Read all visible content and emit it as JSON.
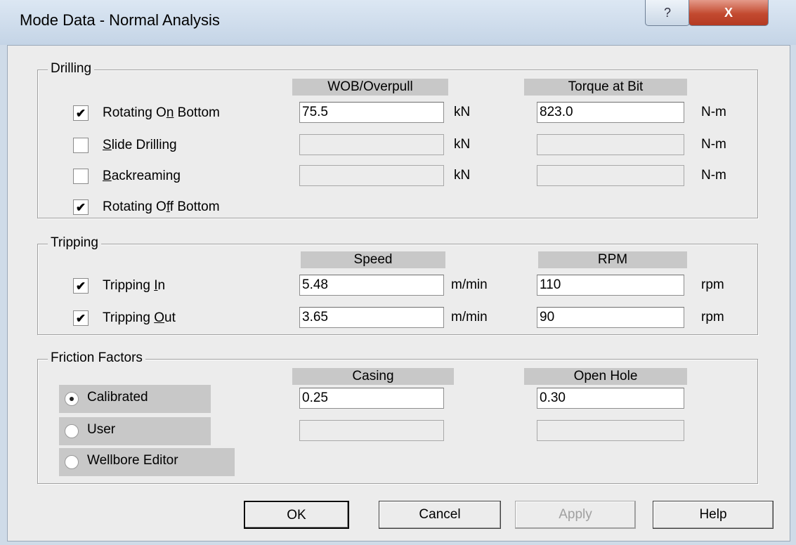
{
  "window": {
    "title": "Mode Data - Normal Analysis",
    "help_glyph": "?",
    "close_glyph": "X"
  },
  "drilling": {
    "legend": "Drilling",
    "col1_header": "WOB/Overpull",
    "col2_header": "Torque at Bit",
    "rows": [
      {
        "label_pre": "Rotating O",
        "label_u": "n",
        "label_post": " Bottom",
        "checked": true,
        "value1": "75.5",
        "unit1": "kN",
        "value2": "823.0",
        "unit2": "N-m"
      },
      {
        "label_pre": "",
        "label_u": "S",
        "label_post": "lide Drilling",
        "checked": false,
        "value1": "",
        "unit1": "kN",
        "value2": "",
        "unit2": "N-m"
      },
      {
        "label_pre": "",
        "label_u": "B",
        "label_post": "ackreaming",
        "checked": false,
        "value1": "",
        "unit1": "kN",
        "value2": "",
        "unit2": "N-m"
      },
      {
        "label_pre": "Rotating O",
        "label_u": "f",
        "label_post": "f Bottom",
        "checked": true
      }
    ]
  },
  "tripping": {
    "legend": "Tripping",
    "col1_header": "Speed",
    "col2_header": "RPM",
    "rows": [
      {
        "label_pre": "Tripping ",
        "label_u": "I",
        "label_post": "n",
        "checked": true,
        "value1": "5.48",
        "unit1": "m/min",
        "value2": "110",
        "unit2": "rpm"
      },
      {
        "label_pre": "Tripping ",
        "label_u": "O",
        "label_post": "ut",
        "checked": true,
        "value1": "3.65",
        "unit1": "m/min",
        "value2": "90",
        "unit2": "rpm"
      }
    ]
  },
  "friction": {
    "legend": "Friction Factors",
    "col1_header": "Casing",
    "col2_header": "Open Hole",
    "options": [
      {
        "label": "Calibrated",
        "selected": true,
        "value1": "0.25",
        "value2": "0.30"
      },
      {
        "label": "User",
        "selected": false,
        "value1": "",
        "value2": ""
      },
      {
        "label": "Wellbore Editor",
        "selected": false
      }
    ]
  },
  "buttons": {
    "ok": "OK",
    "cancel": "Cancel",
    "apply": "Apply",
    "help": "Help"
  },
  "check_glyph": "✔"
}
